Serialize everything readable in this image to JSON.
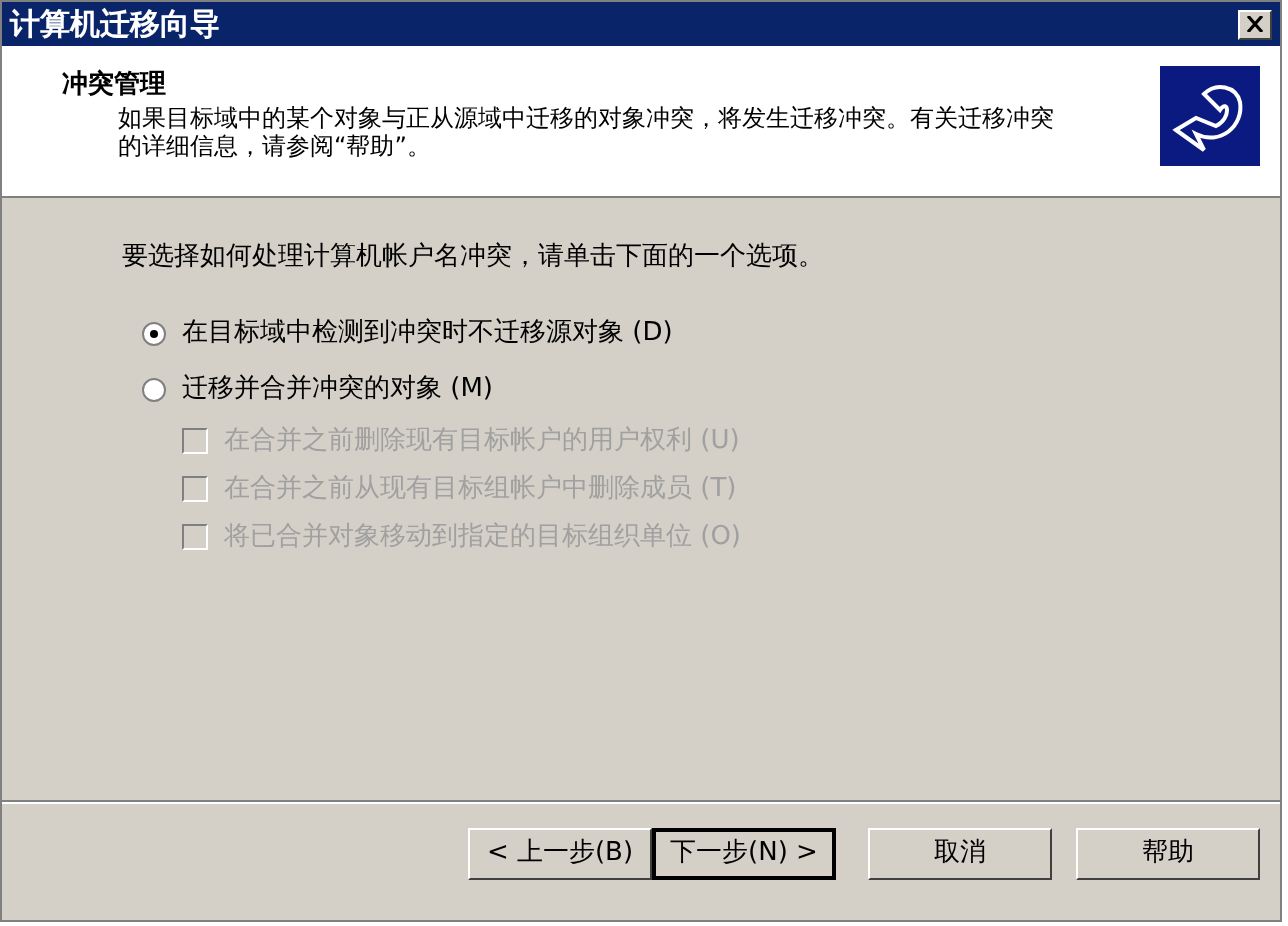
{
  "window": {
    "title": "计算机迁移向导"
  },
  "header": {
    "title": "冲突管理",
    "description": "如果目标域中的某个对象与正从源域中迁移的对象冲突，将发生迁移冲突。有关迁移冲突的详细信息，请参阅“帮助”。"
  },
  "prompt": "要选择如何处理计算机帐户名冲突，请单击下面的一个选项。",
  "options": [
    {
      "label": "在目标域中检测到冲突时不迁移源对象 (D)",
      "selected": true
    },
    {
      "label": "迁移并合并冲突的对象 (M)",
      "selected": false
    }
  ],
  "suboptions": [
    {
      "label": "在合并之前删除现有目标帐户的用户权利 (U)",
      "checked": false,
      "disabled": true
    },
    {
      "label": "在合并之前从现有目标组帐户中删除成员 (T)",
      "checked": false,
      "disabled": true
    },
    {
      "label": "将已合并对象移动到指定的目标组织单位 (O)",
      "checked": false,
      "disabled": true
    }
  ],
  "buttons": [
    {
      "label": "< 上一步(B)",
      "default": false
    },
    {
      "label": "下一步(N) >",
      "default": true
    },
    {
      "label": "取消",
      "default": false
    },
    {
      "label": "帮助",
      "default": false
    }
  ]
}
